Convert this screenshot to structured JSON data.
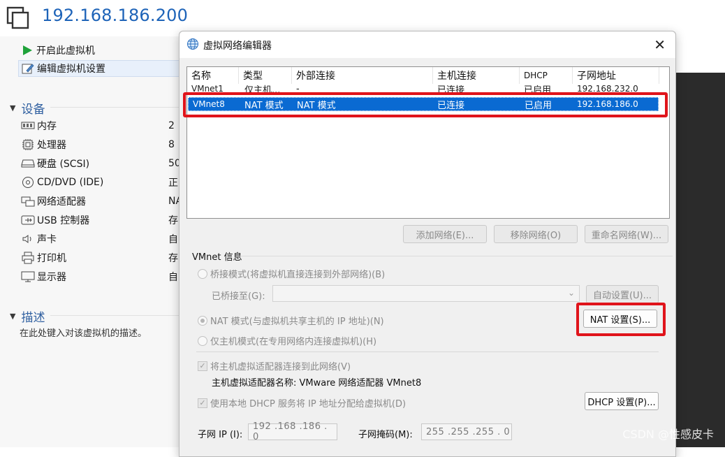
{
  "vm": {
    "title": "192.168.186.200",
    "actions": [
      "开启此虚拟机",
      "编辑虚拟机设置"
    ],
    "devices_header": "设备",
    "devices": [
      {
        "icon": "memory-icon",
        "label": "内存",
        "value": "2"
      },
      {
        "icon": "cpu-icon",
        "label": "处理器",
        "value": "8"
      },
      {
        "icon": "hard-disk-icon",
        "label": "硬盘 (SCSI)",
        "value": "50"
      },
      {
        "icon": "cd-dvd-icon",
        "label": "CD/DVD (IDE)",
        "value": "正"
      },
      {
        "icon": "network-adapter-icon",
        "label": "网络适配器",
        "value": "NA"
      },
      {
        "icon": "usb-icon",
        "label": "USB 控制器",
        "value": "存"
      },
      {
        "icon": "sound-card-icon",
        "label": "声卡",
        "value": "自"
      },
      {
        "icon": "printer-icon",
        "label": "打印机",
        "value": "存"
      },
      {
        "icon": "display-icon",
        "label": "显示器",
        "value": "自"
      }
    ],
    "description_header": "描述",
    "description_placeholder": "在此处键入对该虚拟机的描述。"
  },
  "dialog": {
    "title": "虚拟网络编辑器",
    "columns": [
      "名称",
      "类型",
      "外部连接",
      "主机连接",
      "DHCP",
      "子网地址"
    ],
    "rows": [
      [
        "VMnet1",
        "仅主机...",
        "-",
        "已连接",
        "已启用",
        "192.168.232.0"
      ],
      [
        "VMnet8",
        "NAT 模式",
        "NAT 模式",
        "已连接",
        "已启用",
        "192.168.186.0"
      ]
    ],
    "selected_row": 1,
    "buttons": {
      "add_network": "添加网络(E)...",
      "remove_network": "移除网络(O)",
      "rename_network": "重命名网络(W)..."
    },
    "vmnet_info_label": "VMnet 信息",
    "bridged_mode": "桥接模式(将虚拟机直接连接到外部网络)(B)",
    "bridged_to_label": "已桥接至(G):",
    "auto_settings": "自动设置(U)...",
    "nat_mode": "NAT 模式(与虚拟机共享主机的 IP 地址)(N)",
    "nat_settings": "NAT 设置(S)...",
    "host_only_mode": "仅主机模式(在专用网络内连接虚拟机)(H)",
    "connect_host_adapter": "将主机虚拟适配器连接到此网络(V)",
    "host_adapter_name": "主机虚拟适配器名称: VMware 网络适配器 VMnet8",
    "use_dhcp": "使用本地 DHCP 服务将 IP 地址分配给虚拟机(D)",
    "dhcp_settings": "DHCP 设置(P)...",
    "subnet_ip_label": "子网 IP (I):",
    "subnet_ip": "192 .168 .186 . 0",
    "subnet_mask_label": "子网掩码(M):",
    "subnet_mask": "255 .255 .255 . 0"
  },
  "watermark": "CSDN @性感皮卡",
  "colors": {
    "accent": "#1d63b8",
    "selection": "#0a6ad2",
    "highlight": "#e0141b",
    "play": "#1fa23a"
  }
}
